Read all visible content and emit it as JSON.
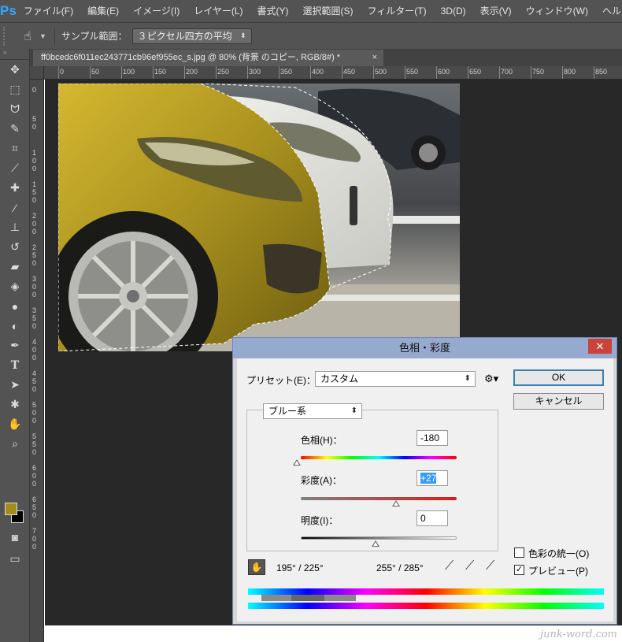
{
  "app": {
    "logo": "Ps"
  },
  "menu": [
    "ファイル(F)",
    "編集(E)",
    "イメージ(I)",
    "レイヤー(L)",
    "書式(Y)",
    "選択範囲(S)",
    "フィルター(T)",
    "3D(D)",
    "表示(V)",
    "ウィンドウ(W)",
    "ヘルプ(H)"
  ],
  "options_bar": {
    "tool_icon": "hand-icon",
    "sample_label": "サンプル範囲：",
    "sample_value": "３ピクセル四方の平均"
  },
  "document_tab": {
    "title": "ff0bcedc6f011ec243771cb96ef955ec_s.jpg @ 80% (背景 のコピー, RGB/8#) *",
    "close": "×"
  },
  "ruler_h": [
    "0",
    "50",
    "100",
    "150",
    "200",
    "250",
    "300",
    "350",
    "400",
    "450",
    "500",
    "550",
    "600",
    "650",
    "700",
    "750",
    "800",
    "850"
  ],
  "ruler_v": [
    "0",
    "50",
    "100",
    "150",
    "200",
    "250",
    "300",
    "350",
    "400",
    "450",
    "500",
    "550",
    "600",
    "650",
    "700"
  ],
  "tools": [
    "move-icon",
    "marquee-icon",
    "lasso-icon",
    "quick-select-icon",
    "crop-icon",
    "eyedropper-icon",
    "healing-icon",
    "brush-icon",
    "stamp-icon",
    "history-brush-icon",
    "eraser-icon",
    "bucket-icon",
    "blur-icon",
    "dodge-icon",
    "pen-icon",
    "type-icon",
    "path-select-icon",
    "shape-icon",
    "hand-icon",
    "zoom-icon"
  ],
  "colors": {
    "foreground": "#a58a1c",
    "background": "#000000",
    "accent": "#96a9cf"
  },
  "dialog": {
    "title": "色相・彩度",
    "close": "✕",
    "preset_label": "プリセット(E)：",
    "preset_value": "カスタム",
    "ok": "OK",
    "cancel": "キャンセル",
    "channel": "ブルー系",
    "hue_label": "色相(H)：",
    "hue_value": "-180",
    "saturation_label": "彩度(A)：",
    "saturation_value": "+27",
    "lightness_label": "明度(I)：",
    "lightness_value": "0",
    "colorize_label": "色彩の統一(O)",
    "colorize_checked": false,
    "preview_label": "プレビュー(P)",
    "preview_checked": true,
    "range_left": "195° / 225°",
    "range_right": "255° / 285°"
  },
  "watermark": "junk-word.com"
}
